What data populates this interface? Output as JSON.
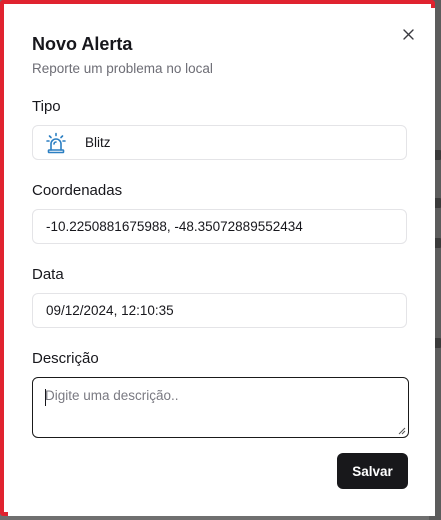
{
  "dialog": {
    "title": "Novo Alerta",
    "subtitle": "Reporte um problema no local",
    "close_icon": "close-icon"
  },
  "fields": {
    "type": {
      "label": "Tipo",
      "value": "Blitz",
      "icon": "police-siren-icon"
    },
    "coordinates": {
      "label": "Coordenadas",
      "value": "-10.2250881675988, -48.35072889552434"
    },
    "date": {
      "label": "Data",
      "value": "09/12/2024, 12:10:35"
    },
    "description": {
      "label": "Descrição",
      "placeholder": "Digite uma descrição..",
      "value": ""
    }
  },
  "actions": {
    "save_label": "Salvar"
  },
  "colors": {
    "frame_border": "#e0232f",
    "siren_icon": "#2b7fc2",
    "primary_button": "#18181b"
  }
}
